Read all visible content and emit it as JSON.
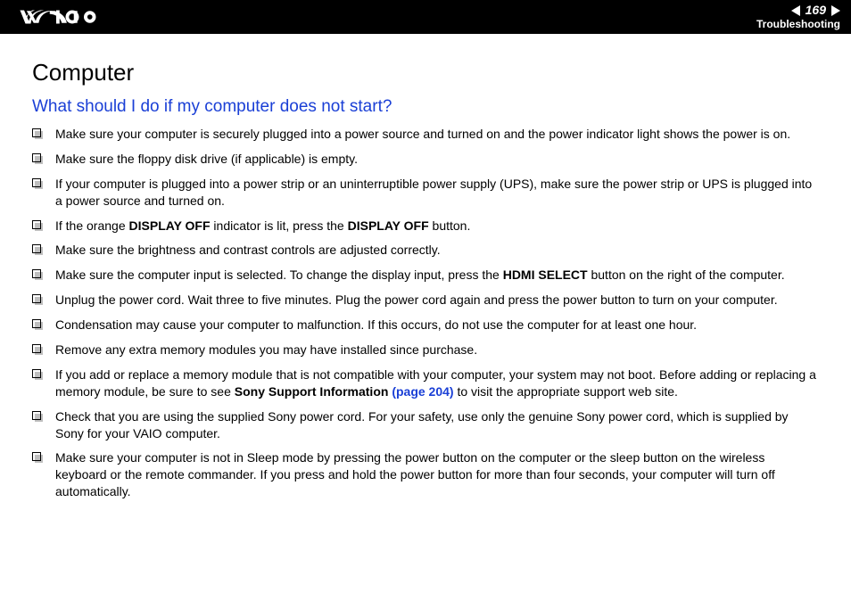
{
  "header": {
    "page_number": "169",
    "section": "Troubleshooting"
  },
  "content": {
    "title": "Computer",
    "subtitle": "What should I do if my computer does not start?",
    "items": [
      {
        "pre": "Make sure your computer is securely plugged into a power source and turned on and the power indicator light shows the power is on."
      },
      {
        "pre": "Make sure the floppy disk drive (if applicable) is empty."
      },
      {
        "pre": "If your computer is plugged into a power strip or an uninterruptible power supply (UPS), make sure the power strip or UPS is plugged into a power source and turned on."
      },
      {
        "pre": "If the orange ",
        "b1": "DISPLAY OFF",
        "mid": " indicator is lit, press the ",
        "b2": "DISPLAY OFF",
        "post": " button."
      },
      {
        "pre": "Make sure the brightness and contrast controls are adjusted correctly."
      },
      {
        "pre": "Make sure the computer input is selected. To change the display input, press the ",
        "b1": "HDMI SELECT",
        "post": " button on the right of the computer."
      },
      {
        "pre": "Unplug the power cord. Wait three to five minutes. Plug the power cord again and press the power button to turn on your computer."
      },
      {
        "pre": "Condensation may cause your computer to malfunction. If this occurs, do not use the computer for at least one hour."
      },
      {
        "pre": "Remove any extra memory modules you may have installed since purchase."
      },
      {
        "pre": "If you add or replace a memory module that is not compatible with your computer, your system may not boot. Before adding or replacing a memory module, be sure to see ",
        "b1": "Sony Support Information ",
        "link": "(page 204)",
        "post": " to visit the appropriate support web site."
      },
      {
        "pre": "Check that you are using the supplied Sony power cord. For your safety, use only the genuine Sony power cord, which is supplied by Sony for your VAIO computer."
      },
      {
        "pre": "Make sure your computer is not in Sleep mode by pressing the power button on the computer or the sleep button on the wireless keyboard or the remote commander. If you press and hold the power button for more than four seconds, your computer will turn off automatically."
      }
    ]
  }
}
